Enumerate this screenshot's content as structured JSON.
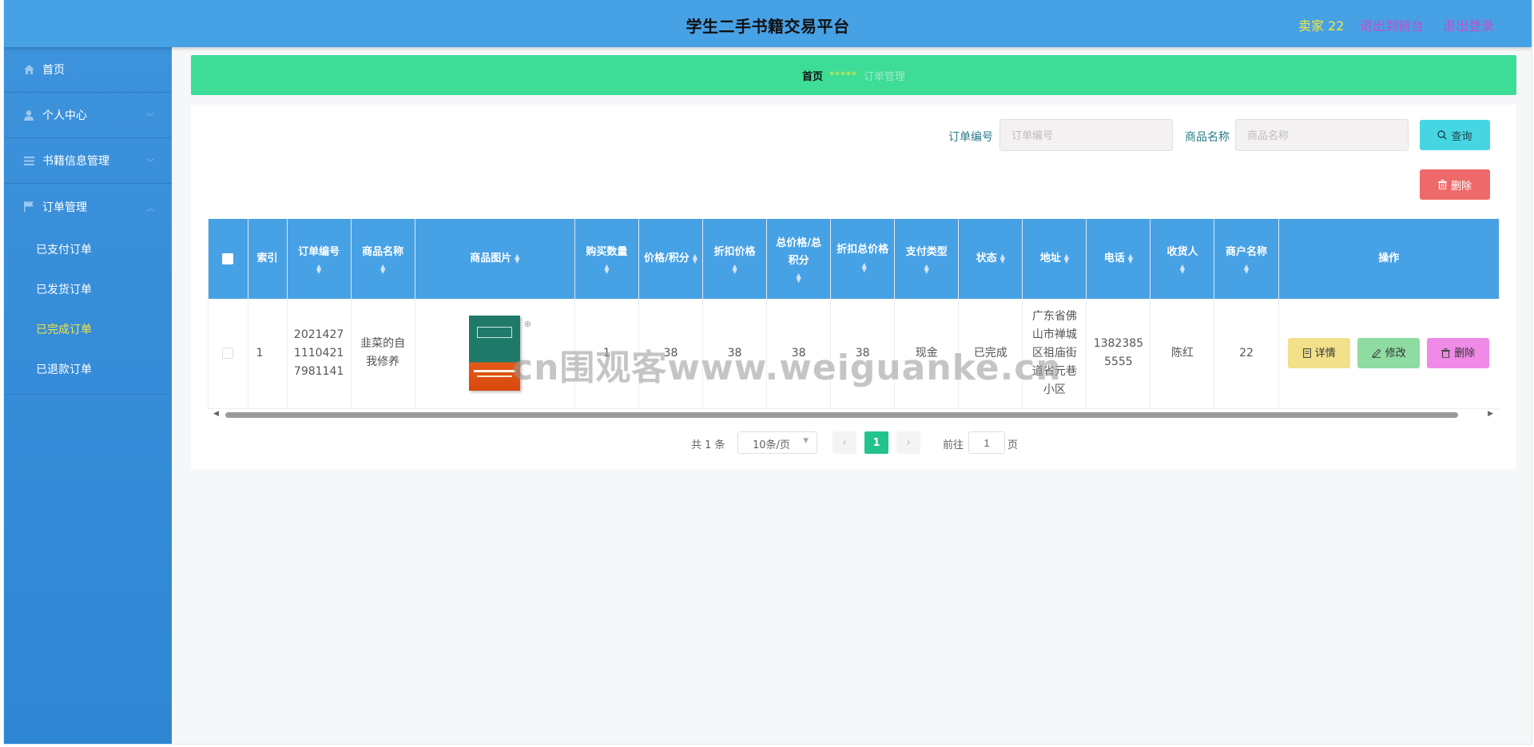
{
  "header": {
    "title": "学生二手书籍交易平台",
    "user": "卖家 22",
    "front_link": "退出到前台",
    "logout_link": "退出登录"
  },
  "sidebar": {
    "items": [
      {
        "label": "首页",
        "icon": "home-icon"
      },
      {
        "label": "个人中心",
        "icon": "user-icon"
      },
      {
        "label": "书籍信息管理",
        "icon": "menu-icon"
      },
      {
        "label": "订单管理",
        "icon": "flag-icon"
      }
    ],
    "sub_items": [
      {
        "label": "已支付订单"
      },
      {
        "label": "已发货订单"
      },
      {
        "label": "已完成订单",
        "active": true
      },
      {
        "label": "已退款订单"
      }
    ]
  },
  "breadcrumb": {
    "home": "首页",
    "separator": "*****",
    "current": "订单管理"
  },
  "search": {
    "order_label": "订单编号",
    "order_placeholder": "订单编号",
    "name_label": "商品名称",
    "name_placeholder": "商品名称",
    "query_button": "查询",
    "delete_button": "删除"
  },
  "table": {
    "columns": [
      "索引",
      "订单编号",
      "商品名称",
      "商品图片",
      "购买数量",
      "价格/积分",
      "折扣价格",
      "总价格/总积分",
      "折扣总价格",
      "支付类型",
      "状态",
      "地址",
      "电话",
      "收货人",
      "商户名称",
      "操作"
    ],
    "rows": [
      {
        "index": "1",
        "order_no": "20214271110421798 1141",
        "order_no_lines": [
          "2021427",
          "1110421",
          "7981141"
        ],
        "product_name": "韭菜的自我修养",
        "quantity": "1",
        "price": "38",
        "discount_price": "38",
        "total_price": "38",
        "discount_total": "38",
        "pay_type": "现金",
        "status": "已完成",
        "address": "广东省佛山市禅城区祖庙街道省元巷小区",
        "phone": "13823855555",
        "receiver": "陈红",
        "merchant": "22"
      }
    ],
    "actions": {
      "detail": "详情",
      "edit": "修改",
      "delete": "删除"
    }
  },
  "pagination": {
    "total": "共 1 条",
    "page_size": "10条/页",
    "current_page": "1",
    "goto_label": "前往",
    "goto_value": "1",
    "page_suffix": "页"
  },
  "watermark": "cn围观客www.weiguanke.cn",
  "colors": {
    "header": "#47a1e5",
    "sidebar": "#3a8fd9",
    "breadcrumb": "#3ddc97",
    "active_menu": "#f5e642",
    "pager_active": "#21c48a"
  }
}
